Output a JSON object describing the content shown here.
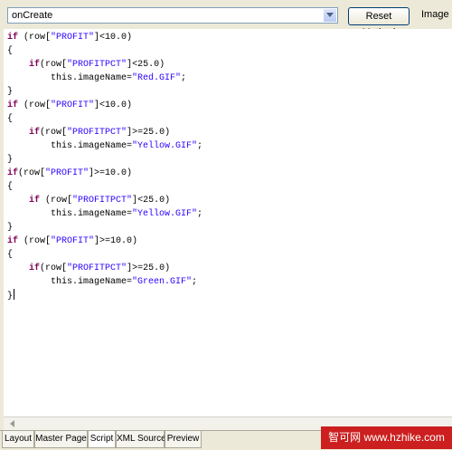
{
  "toolbar": {
    "method_value": "onCreate",
    "reset_label": "Reset Method",
    "image_label": "Image"
  },
  "code": {
    "tokens": [
      [
        [
          "kw",
          "if"
        ],
        [
          "t",
          " (row["
        ],
        [
          "s",
          "\"PROFIT\""
        ],
        [
          "t",
          "]<10.0)"
        ]
      ],
      [
        [
          "t",
          "{"
        ]
      ],
      [
        [
          "t",
          "    "
        ],
        [
          "kw",
          "if"
        ],
        [
          "t",
          "(row["
        ],
        [
          "s",
          "\"PROFITPCT\""
        ],
        [
          "t",
          "]<25.0)"
        ]
      ],
      [
        [
          "t",
          "        this.imageName="
        ],
        [
          "s",
          "\"Red.GIF\""
        ],
        [
          "t",
          ";"
        ]
      ],
      [
        [
          "t",
          "}"
        ]
      ],
      [
        [
          "kw",
          "if"
        ],
        [
          "t",
          " (row["
        ],
        [
          "s",
          "\"PROFIT\""
        ],
        [
          "t",
          "]<10.0)"
        ]
      ],
      [
        [
          "t",
          "{"
        ]
      ],
      [
        [
          "t",
          "    "
        ],
        [
          "kw",
          "if"
        ],
        [
          "t",
          "(row["
        ],
        [
          "s",
          "\"PROFITPCT\""
        ],
        [
          "t",
          "]>=25.0)"
        ]
      ],
      [
        [
          "t",
          "        this.imageName="
        ],
        [
          "s",
          "\"Yellow.GIF\""
        ],
        [
          "t",
          ";"
        ]
      ],
      [
        [
          "t",
          "}"
        ]
      ],
      [
        [
          "kw",
          "if"
        ],
        [
          "t",
          "(row["
        ],
        [
          "s",
          "\"PROFIT\""
        ],
        [
          "t",
          "]>=10.0)"
        ]
      ],
      [
        [
          "t",
          "{"
        ]
      ],
      [
        [
          "t",
          "    "
        ],
        [
          "kw",
          "if"
        ],
        [
          "t",
          " (row["
        ],
        [
          "s",
          "\"PROFITPCT\""
        ],
        [
          "t",
          "]<25.0)"
        ]
      ],
      [
        [
          "t",
          "        this.imageName="
        ],
        [
          "s",
          "\"Yellow.GIF\""
        ],
        [
          "t",
          ";"
        ]
      ],
      [
        [
          "t",
          "}"
        ]
      ],
      [
        [
          "kw",
          "if"
        ],
        [
          "t",
          " (row["
        ],
        [
          "s",
          "\"PROFIT\""
        ],
        [
          "t",
          "]>=10.0)"
        ]
      ],
      [
        [
          "t",
          "{"
        ]
      ],
      [
        [
          "t",
          "    "
        ],
        [
          "kw",
          "if"
        ],
        [
          "t",
          "(row["
        ],
        [
          "s",
          "\"PROFITPCT\""
        ],
        [
          "t",
          "]>=25.0)"
        ]
      ],
      [
        [
          "t",
          "        this.imageName="
        ],
        [
          "s",
          "\"Green.GIF\""
        ],
        [
          "t",
          ";"
        ]
      ],
      [
        [
          "t",
          "}"
        ]
      ]
    ]
  },
  "tabs": [
    {
      "label": "Layout",
      "active": false
    },
    {
      "label": "Master Page",
      "active": false
    },
    {
      "label": "Script",
      "active": true
    },
    {
      "label": "XML Source",
      "active": false
    },
    {
      "label": "Preview",
      "active": false
    }
  ],
  "watermark": "智可网 www.hzhike.com",
  "icons": {
    "dropdown": "chevron-down-icon",
    "scroll_left": "arrow-left-icon"
  }
}
